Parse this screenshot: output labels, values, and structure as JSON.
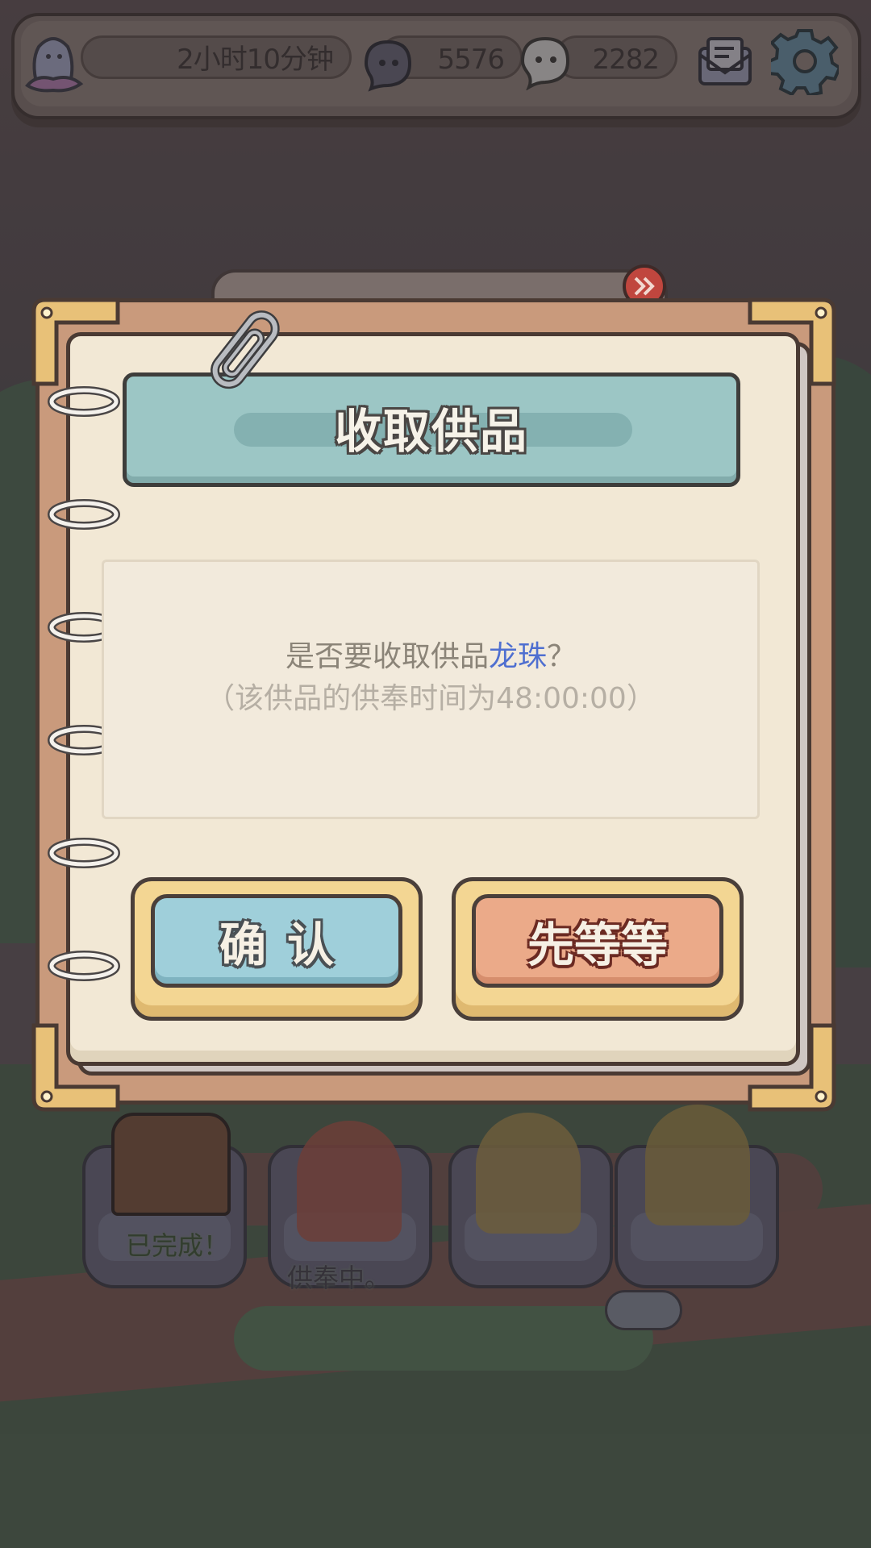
{
  "topbar": {
    "timer": "2小时10分钟",
    "souls_dark": "5576",
    "souls_light": "2282",
    "icons": [
      "ghost-avatar-icon",
      "dark-soul-icon",
      "light-soul-icon",
      "mail-icon",
      "gear-icon"
    ]
  },
  "dialog": {
    "title": "收取供品",
    "message_prefix": "是否要收取供品",
    "item_name": "龙珠",
    "message_suffix": "？",
    "duration_note": "（该供品的供奉时间为48:00:00）",
    "confirm_label": "确认",
    "wait_label": "先等等",
    "item_color": "#4f6fd0"
  },
  "altars": {
    "done_label": "已完成！",
    "offering_label": "供奉中。"
  }
}
